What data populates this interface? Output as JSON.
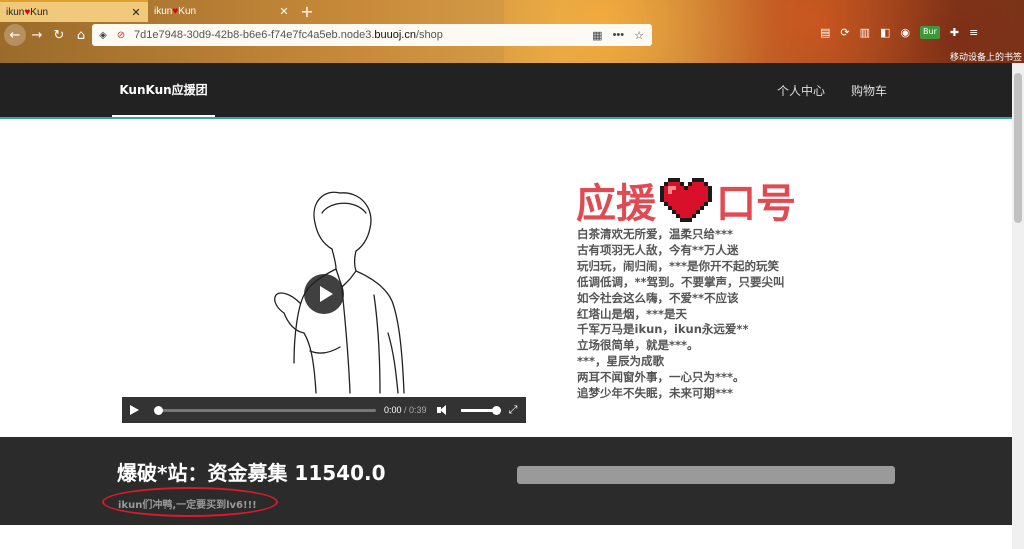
{
  "browser": {
    "tabs": [
      {
        "label_a": "ikun",
        "label_b": "Kun",
        "active": true
      },
      {
        "label_a": "ikun",
        "label_b": "Kun",
        "active": false
      }
    ],
    "new_tab": "+",
    "url_prefix": "7d1e7948-30d9-42b8-b6e6-f74e7fc4a5eb.node3.",
    "url_domain": "buuoj.cn",
    "url_path": "/shop",
    "url_more": "•••",
    "ext_badge": "Bur",
    "bookmark_text": "移动设备上的书签"
  },
  "site": {
    "brand": "KunKun应援团",
    "menu": [
      "个人中心",
      "购物车"
    ]
  },
  "video": {
    "current_time": "0:00",
    "separator": " / ",
    "duration": "0:39",
    "progress": 0,
    "volume": 1.0
  },
  "slogan": {
    "title_left": "应援",
    "title_right": "口号",
    "lines": [
      "白茶清欢无所爱，温柔只给***",
      "古有项羽无人敌，今有**万人迷",
      "玩归玩，闹归闹，***是你开不起的玩笑",
      "低调低调，**驾到。不要掌声，只要尖叫",
      "如今社会这么嗨，不爱**不应该",
      "红塔山是烟，***是天",
      "千军万马是ikun，ikun永远爱**",
      "立场很简单，就是***。",
      "***，星辰为成歌",
      "两耳不闻窗外事，一心只为***。",
      "追梦少年不失眠，未来可期***"
    ]
  },
  "fund": {
    "title": "爆破*站：资金募集 11540.0",
    "subtitle": "ikun们冲鸭,一定要买到lv6!!!"
  },
  "colors": {
    "accent": "#e04a52",
    "navbar": "#222222",
    "fund_bg": "#2b2b2b",
    "highlight_oval": "#d81b2a"
  }
}
